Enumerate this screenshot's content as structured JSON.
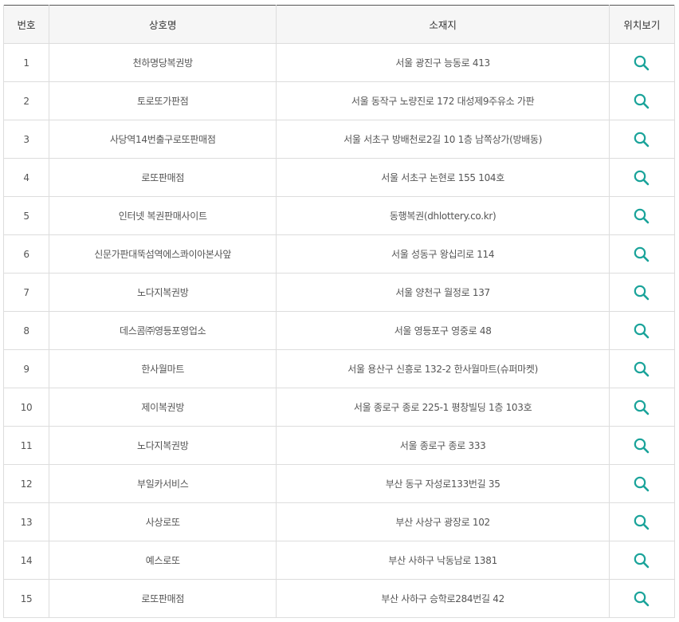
{
  "header": {
    "col_no": "번호",
    "col_name": "상호명",
    "col_address": "소재지",
    "col_map": "위치보기"
  },
  "rows": [
    {
      "no": "1",
      "name": "천하명당복권방",
      "address": "서울 광진구 능동로 413"
    },
    {
      "no": "2",
      "name": "토로또가판점",
      "address": "서울 동작구 노량진로 172 대성제9주유소 가판"
    },
    {
      "no": "3",
      "name": "사당역14번출구로또판매점",
      "address": "서울 서초구 방배천로2길 10 1층 남쪽상가(방배동)"
    },
    {
      "no": "4",
      "name": "로또판매점",
      "address": "서울 서초구 논현로 155 104호"
    },
    {
      "no": "5",
      "name": "인터넷 복권판매사이트",
      "address": "동행복권(dhlottery.co.kr)"
    },
    {
      "no": "6",
      "name": "신문가판대뚝섬역에스콰이아본사앞",
      "address": "서울 성동구 왕십리로 114"
    },
    {
      "no": "7",
      "name": "노다지복권방",
      "address": "서울 양천구 월정로 137"
    },
    {
      "no": "8",
      "name": "데스콤㈜영등포영업소",
      "address": "서울 영등포구 영중로 48"
    },
    {
      "no": "9",
      "name": "한사월마트",
      "address": "서울 용산구 신흥로 132-2 한사월마트(슈퍼마켓)"
    },
    {
      "no": "10",
      "name": "제이복권방",
      "address": "서울 종로구 종로 225-1 평창빌딩 1층 103호"
    },
    {
      "no": "11",
      "name": "노다지복권방",
      "address": "서울 종로구 종로 333"
    },
    {
      "no": "12",
      "name": "부일카서비스",
      "address": "부산 동구 자성로133번길 35"
    },
    {
      "no": "13",
      "name": "사상로또",
      "address": "부산 사상구 광장로 102"
    },
    {
      "no": "14",
      "name": "예스로또",
      "address": "부산 사하구 낙동남로 1381"
    },
    {
      "no": "15",
      "name": "로또판매점",
      "address": "부산 사하구 승학로284번길 42"
    }
  ],
  "icons": {
    "map_icon": "search-icon"
  },
  "colors": {
    "accent": "#1aa39a",
    "header_bg": "#f6f6f6",
    "border": "#dddddd",
    "top_border": "#555555"
  }
}
